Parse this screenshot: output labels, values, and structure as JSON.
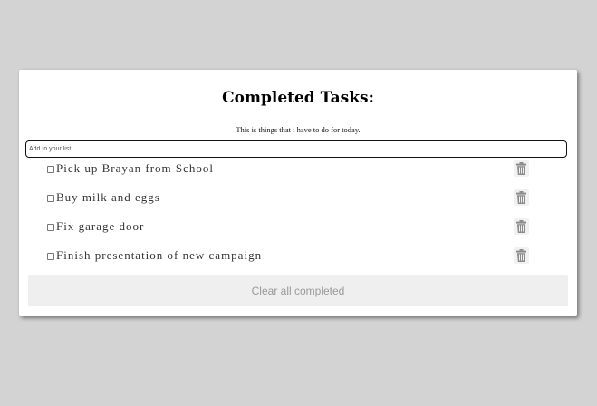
{
  "app": {
    "title": "Completed Tasks:",
    "subtitle": "This is things that i have to do for today."
  },
  "add_input": {
    "placeholder": "Add to your list..",
    "value": ""
  },
  "tasks": [
    {
      "label": "Pick up Brayan from School",
      "checked": false
    },
    {
      "label": "Buy milk and eggs",
      "checked": false
    },
    {
      "label": "Fix garage door",
      "checked": false
    },
    {
      "label": "Finish presentation of new campaign",
      "checked": false
    }
  ],
  "icons": {
    "delete": "trash-icon"
  },
  "footer": {
    "clear_label": "Clear all completed"
  },
  "colors": {
    "background": "#d3d3d3",
    "card": "#ffffff",
    "task_text": "#333333",
    "button_bg": "#efefef",
    "button_text": "#999999",
    "trash": "#8a8a8a"
  }
}
